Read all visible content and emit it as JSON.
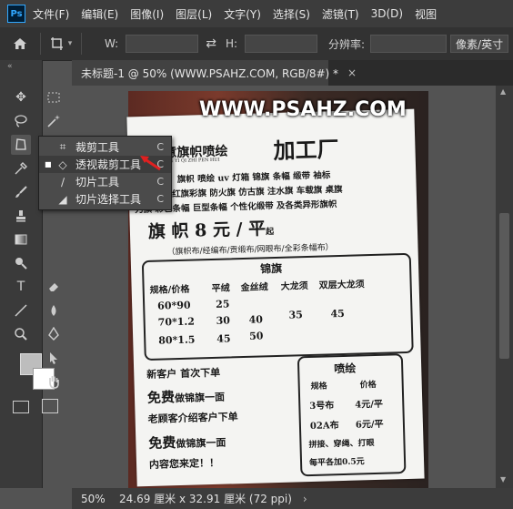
{
  "app": {
    "logo": "Ps"
  },
  "menu": [
    "文件(F)",
    "编辑(E)",
    "图像(I)",
    "图层(L)",
    "文字(Y)",
    "选择(S)",
    "滤镜(T)",
    "3D(D)",
    "视图"
  ],
  "options": {
    "w_label": "W:",
    "h_label": "H:",
    "resolution_label": "分辨率:",
    "unit_label": "像素/英寸"
  },
  "document": {
    "tab_title": "未标题-1 @ 50% (WWW.PSAHZ.COM, RGB/8#) *",
    "close_label": "×"
  },
  "flyout": {
    "items": [
      {
        "label": "裁剪工具",
        "shortcut": "C"
      },
      {
        "label": "透视裁剪工具",
        "shortcut": "C"
      },
      {
        "label": "切片工具",
        "shortcut": "C"
      },
      {
        "label": "切片选择工具",
        "shortcut": "C"
      }
    ]
  },
  "status": {
    "zoom": "50%",
    "info": "24.69 厘米 x 32.91 厘米 (72 ppi)",
    "arrow": "›"
  },
  "photo": {
    "watermark": "WWW.PSAHZ.COM",
    "header_left": "新创意旗帜喷绘",
    "header_pinyin": "XIN CHUANG YI QI ZHI PEN HUI",
    "header_right": "加工厂",
    "line1": "专业制作：旗帜 喷绘  uv  灯箱 锦旗 条幅 缎带 袖标",
    "line2": "桌旗 流动红旗彩旗 防火旗 仿古旗 注水旗 车载旗 桌旗",
    "line3": "刀旗 彩色条幅 巨型条幅 个性化缎带 及各类异形旗帜",
    "price_big": "旗 帜 8 元 / 平",
    "price_suffix": "起",
    "materials": "（旗帜布/经编布/贡缎布/网眼布/全彩条幅布）",
    "table_title": "锦旗",
    "table_headers": [
      "规格/价格",
      "平绒",
      "金丝绒",
      "大龙须",
      "双层大龙须"
    ],
    "table_rows": [
      [
        "60*90",
        "25",
        "",
        "",
        ""
      ],
      [
        "70*1.2",
        "30",
        "40",
        "35",
        "45"
      ],
      [
        "80*1.5",
        "45",
        "50",
        "",
        ""
      ]
    ],
    "promo1": "新客户 首次下单",
    "promo2_big": "免费",
    "promo2_rest": "做锦旗一面",
    "promo3": "老顾客介绍客户下单",
    "promo4_big": "免费",
    "promo4_rest": "做锦旗一面",
    "promo5": "内容您来定！！",
    "spray_title": "喷绘",
    "spray_headers": [
      "规格",
      "价格"
    ],
    "spray_rows": [
      [
        "3号布",
        "4元/平"
      ],
      [
        "02A布",
        "6元/平"
      ]
    ],
    "spray_note1": "拼接、穿绳、打眼",
    "spray_note2": "每平各加0.5元"
  }
}
